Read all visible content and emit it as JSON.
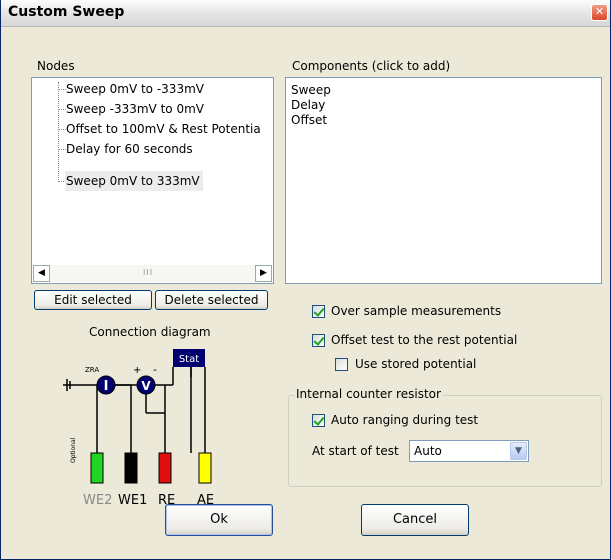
{
  "window": {
    "title": "Custom Sweep",
    "close_glyph": "✕"
  },
  "nodes": {
    "label": "Nodes",
    "items": [
      {
        "label": "Sweep 0mV to -333mV",
        "selected": false
      },
      {
        "label": "Sweep -333mV to 0mV",
        "selected": false
      },
      {
        "label": "Offset to 100mV & Rest Potentia",
        "selected": false
      },
      {
        "label": "Delay for 60 seconds",
        "selected": false
      },
      {
        "label": "Sweep 0mV to 333mV",
        "selected": true
      }
    ],
    "scroll_left": "◀",
    "scroll_right": "▶",
    "scroll_thumb": "III"
  },
  "components": {
    "label": "Components (click to add)",
    "items": [
      "Sweep",
      "Delay",
      "Offset"
    ]
  },
  "buttons": {
    "edit": "Edit selected",
    "delete": "Delete selected",
    "ok": "Ok",
    "cancel": "Cancel"
  },
  "diagram": {
    "title": "Connection diagram",
    "stat": "Stat",
    "zra": "ZRA",
    "plus": "+",
    "minus": "-",
    "current_symbol": "I",
    "voltage_symbol": "V",
    "optional": "Optional",
    "leads": [
      {
        "label": "WE2",
        "color": "#21d621",
        "muted": true
      },
      {
        "label": "WE1",
        "color": "#000000",
        "muted": false
      },
      {
        "label": "RE",
        "color": "#e01010",
        "muted": false
      },
      {
        "label": "AE",
        "color": "#ffff00",
        "muted": false
      }
    ]
  },
  "options": {
    "oversample": {
      "label": "Over sample measurements",
      "checked": true
    },
    "offset_rest": {
      "label": "Offset test to the rest potential",
      "checked": true
    },
    "stored_potential": {
      "label": "Use stored potential",
      "checked": false
    }
  },
  "resistor": {
    "legend": "Internal counter resistor",
    "auto_ranging": {
      "label": "Auto ranging during test",
      "checked": true
    },
    "start_label": "At start of test",
    "start_value": "Auto",
    "dropdown_glyph": "▼"
  }
}
